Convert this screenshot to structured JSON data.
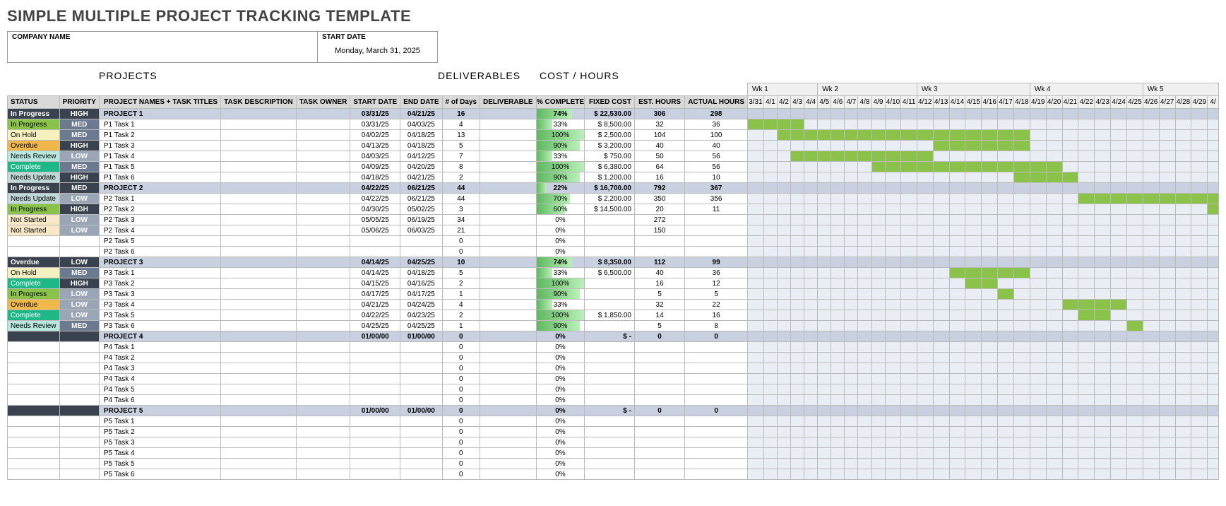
{
  "title": "SIMPLE MULTIPLE PROJECT TRACKING TEMPLATE",
  "companyLabel": "COMPANY NAME",
  "startDateLabel": "START DATE",
  "startDate": "Monday, March 31, 2025",
  "sections": {
    "projects": "PROJECTS",
    "deliverables": "DELIVERABLES",
    "cost": "COST / HOURS"
  },
  "cols": {
    "status": "STATUS",
    "priority": "PRIORITY",
    "name": "PROJECT NAMES + TASK TITLES",
    "desc": "TASK DESCRIPTION",
    "owner": "TASK OWNER",
    "sd": "START DATE",
    "ed": "END DATE",
    "days": "# of Days",
    "deliv": "DELIVERABLE",
    "pct": "% COMPLETE",
    "cost": "FIXED COST",
    "eh": "EST. HOURS",
    "ah": "ACTUAL HOURS"
  },
  "weeks": [
    "Wk 1",
    "Wk 2",
    "Wk 3",
    "Wk 4",
    "Wk 5"
  ],
  "days": [
    "3/31",
    "4/1",
    "4/2",
    "4/3",
    "4/4",
    "4/5",
    "4/6",
    "4/7",
    "4/8",
    "4/9",
    "4/10",
    "4/11",
    "4/12",
    "4/13",
    "4/14",
    "4/15",
    "4/16",
    "4/17",
    "4/18",
    "4/19",
    "4/20",
    "4/21",
    "4/22",
    "4/23",
    "4/24",
    "4/25",
    "4/26",
    "4/27",
    "4/28",
    "4/29",
    "4/"
  ],
  "rows": [
    {
      "p": 1,
      "st": "In Progress",
      "pr": "HIGH",
      "nm": "PROJECT 1",
      "sd": "03/31/25",
      "ed": "04/21/25",
      "dy": "16",
      "pc": 74,
      "c": "$      22,530.00",
      "eh": "306",
      "ah": "298",
      "gs": 0,
      "ge": 21
    },
    {
      "st": "In Progress",
      "pr": "MED",
      "nm": "P1 Task 1",
      "sd": "03/31/25",
      "ed": "04/03/25",
      "dy": "4",
      "pc": 33,
      "c": "$        8,500.00",
      "eh": "32",
      "ah": "36",
      "gs": 0,
      "ge": 3
    },
    {
      "st": "On Hold",
      "pr": "MED",
      "nm": "P1 Task 2",
      "sd": "04/02/25",
      "ed": "04/18/25",
      "dy": "13",
      "pc": 100,
      "c": "$        2,500.00",
      "eh": "104",
      "ah": "100",
      "gs": 2,
      "ge": 18
    },
    {
      "st": "Overdue",
      "pr": "HIGH",
      "nm": "P1 Task 3",
      "sd": "04/13/25",
      "ed": "04/18/25",
      "dy": "5",
      "pc": 90,
      "c": "$        3,200.00",
      "eh": "40",
      "ah": "40",
      "gs": 13,
      "ge": 18
    },
    {
      "st": "Needs Review",
      "pr": "LOW",
      "nm": "P1 Task 4",
      "sd": "04/03/25",
      "ed": "04/12/25",
      "dy": "7",
      "pc": 33,
      "c": "$           750.00",
      "eh": "50",
      "ah": "56",
      "gs": 3,
      "ge": 12
    },
    {
      "st": "Complete",
      "pr": "MED",
      "nm": "P1 Task 5",
      "sd": "04/09/25",
      "ed": "04/20/25",
      "dy": "8",
      "pc": 100,
      "c": "$        6,380.00",
      "eh": "64",
      "ah": "56",
      "gs": 9,
      "ge": 20
    },
    {
      "st": "Needs Update",
      "pr": "HIGH",
      "nm": "P1 Task 6",
      "sd": "04/18/25",
      "ed": "04/21/25",
      "dy": "2",
      "pc": 90,
      "c": "$        1,200.00",
      "eh": "16",
      "ah": "10",
      "gs": 18,
      "ge": 21
    },
    {
      "p": 1,
      "st": "In Progress",
      "pr": "MED",
      "nm": "PROJECT 2",
      "sd": "04/22/25",
      "ed": "06/21/25",
      "dy": "44",
      "pc": 22,
      "c": "$      16,700.00",
      "eh": "792",
      "ah": "367",
      "gs": 22,
      "ge": 31
    },
    {
      "st": "Needs Update",
      "pr": "LOW",
      "nm": "P2 Task 1",
      "sd": "04/22/25",
      "ed": "06/21/25",
      "dy": "44",
      "pc": 70,
      "c": "$        2,200.00",
      "eh": "350",
      "ah": "356",
      "gs": 22,
      "ge": 31
    },
    {
      "st": "In Progress",
      "pr": "HIGH",
      "nm": "P2 Task 2",
      "sd": "04/30/25",
      "ed": "05/02/25",
      "dy": "3",
      "pc": 60,
      "c": "$      14,500.00",
      "eh": "20",
      "ah": "11",
      "gs": 30,
      "ge": 31
    },
    {
      "st": "Not Started",
      "pr": "LOW",
      "nm": "P2 Task 3",
      "sd": "05/05/25",
      "ed": "06/19/25",
      "dy": "34",
      "pc": 0,
      "c": "",
      "eh": "272",
      "ah": ""
    },
    {
      "st": "Not Started",
      "pr": "LOW",
      "nm": "P2 Task 4",
      "sd": "05/06/25",
      "ed": "06/03/25",
      "dy": "21",
      "pc": 0,
      "c": "",
      "eh": "150",
      "ah": ""
    },
    {
      "st": "",
      "pr": "",
      "nm": "P2 Task 5",
      "sd": "",
      "ed": "",
      "dy": "0",
      "pc": 0,
      "c": "",
      "eh": "",
      "ah": ""
    },
    {
      "st": "",
      "pr": "",
      "nm": "P2 Task 6",
      "sd": "",
      "ed": "",
      "dy": "0",
      "pc": 0,
      "c": "",
      "eh": "",
      "ah": ""
    },
    {
      "p": 1,
      "st": "Overdue",
      "pr": "LOW",
      "nm": "PROJECT 3",
      "sd": "04/14/25",
      "ed": "04/25/25",
      "dy": "10",
      "pc": 74,
      "c": "$        8,350.00",
      "eh": "112",
      "ah": "99",
      "gs": 14,
      "ge": 25
    },
    {
      "st": "On Hold",
      "pr": "MED",
      "nm": "P3 Task 1",
      "sd": "04/14/25",
      "ed": "04/18/25",
      "dy": "5",
      "pc": 33,
      "c": "$        6,500.00",
      "eh": "40",
      "ah": "36",
      "gs": 14,
      "ge": 18
    },
    {
      "st": "Complete",
      "pr": "HIGH",
      "nm": "P3 Task 2",
      "sd": "04/15/25",
      "ed": "04/16/25",
      "dy": "2",
      "pc": 100,
      "c": "",
      "eh": "16",
      "ah": "12",
      "gs": 15,
      "ge": 16
    },
    {
      "st": "In Progress",
      "pr": "LOW",
      "nm": "P3 Task 3",
      "sd": "04/17/25",
      "ed": "04/17/25",
      "dy": "1",
      "pc": 90,
      "c": "",
      "eh": "5",
      "ah": "5",
      "gs": 17,
      "ge": 17
    },
    {
      "st": "Overdue",
      "pr": "LOW",
      "nm": "P3 Task 4",
      "sd": "04/21/25",
      "ed": "04/24/25",
      "dy": "4",
      "pc": 33,
      "c": "",
      "eh": "32",
      "ah": "22",
      "gs": 21,
      "ge": 24
    },
    {
      "st": "Complete",
      "pr": "LOW",
      "nm": "P3 Task 5",
      "sd": "04/22/25",
      "ed": "04/23/25",
      "dy": "2",
      "pc": 100,
      "c": "$        1,850.00",
      "eh": "14",
      "ah": "16",
      "gs": 22,
      "ge": 23
    },
    {
      "st": "Needs Review",
      "pr": "MED",
      "nm": "P3 Task 6",
      "sd": "04/25/25",
      "ed": "04/25/25",
      "dy": "1",
      "pc": 90,
      "c": "",
      "eh": "5",
      "ah": "8",
      "gs": 25,
      "ge": 25
    },
    {
      "p": 1,
      "st": "",
      "pr": "",
      "nm": "PROJECT 4",
      "sd": "01/00/00",
      "ed": "01/00/00",
      "dy": "0",
      "pc": 0,
      "c": "$            -",
      "eh": "0",
      "ah": "0"
    },
    {
      "st": "",
      "pr": "",
      "nm": "P4 Task 1",
      "sd": "",
      "ed": "",
      "dy": "0",
      "pc": 0,
      "c": "",
      "eh": "",
      "ah": ""
    },
    {
      "st": "",
      "pr": "",
      "nm": "P4 Task 2",
      "sd": "",
      "ed": "",
      "dy": "0",
      "pc": 0,
      "c": "",
      "eh": "",
      "ah": ""
    },
    {
      "st": "",
      "pr": "",
      "nm": "P4 Task 3",
      "sd": "",
      "ed": "",
      "dy": "0",
      "pc": 0,
      "c": "",
      "eh": "",
      "ah": ""
    },
    {
      "st": "",
      "pr": "",
      "nm": "P4 Task 4",
      "sd": "",
      "ed": "",
      "dy": "0",
      "pc": 0,
      "c": "",
      "eh": "",
      "ah": ""
    },
    {
      "st": "",
      "pr": "",
      "nm": "P4 Task 5",
      "sd": "",
      "ed": "",
      "dy": "0",
      "pc": 0,
      "c": "",
      "eh": "",
      "ah": ""
    },
    {
      "st": "",
      "pr": "",
      "nm": "P4 Task 6",
      "sd": "",
      "ed": "",
      "dy": "0",
      "pc": 0,
      "c": "",
      "eh": "",
      "ah": ""
    },
    {
      "p": 1,
      "st": "",
      "pr": "",
      "nm": "PROJECT 5",
      "sd": "01/00/00",
      "ed": "01/00/00",
      "dy": "0",
      "pc": 0,
      "c": "$            -",
      "eh": "0",
      "ah": "0"
    },
    {
      "st": "",
      "pr": "",
      "nm": "P5 Task 1",
      "sd": "",
      "ed": "",
      "dy": "0",
      "pc": 0,
      "c": "",
      "eh": "",
      "ah": ""
    },
    {
      "st": "",
      "pr": "",
      "nm": "P5 Task 2",
      "sd": "",
      "ed": "",
      "dy": "0",
      "pc": 0,
      "c": "",
      "eh": "",
      "ah": ""
    },
    {
      "st": "",
      "pr": "",
      "nm": "P5 Task 3",
      "sd": "",
      "ed": "",
      "dy": "0",
      "pc": 0,
      "c": "",
      "eh": "",
      "ah": ""
    },
    {
      "st": "",
      "pr": "",
      "nm": "P5 Task 4",
      "sd": "",
      "ed": "",
      "dy": "0",
      "pc": 0,
      "c": "",
      "eh": "",
      "ah": ""
    },
    {
      "st": "",
      "pr": "",
      "nm": "P5 Task 5",
      "sd": "",
      "ed": "",
      "dy": "0",
      "pc": 0,
      "c": "",
      "eh": "",
      "ah": ""
    },
    {
      "st": "",
      "pr": "",
      "nm": "P5 Task 6",
      "sd": "",
      "ed": "",
      "dy": "0",
      "pc": 0,
      "c": "",
      "eh": "",
      "ah": ""
    }
  ]
}
